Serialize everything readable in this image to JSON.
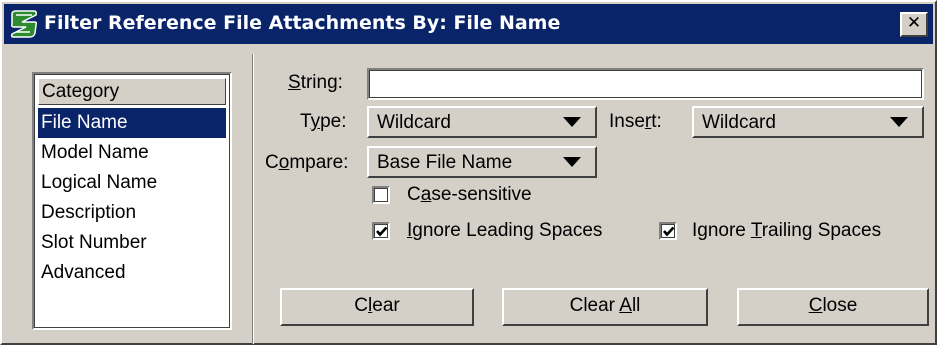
{
  "window": {
    "title": "Filter Reference File Attachments By: File Name",
    "close_label": "✕"
  },
  "category": {
    "header": "Category",
    "items": [
      "File Name",
      "Model Name",
      "Logical Name",
      "Description",
      "Slot Number",
      "Advanced"
    ],
    "selected": "File Name"
  },
  "form": {
    "string_label_pre": "",
    "string_label_key": "S",
    "string_label_post": "tring:",
    "string_value": "",
    "type_label_pre": "T",
    "type_label_key": "y",
    "type_label_post": "pe:",
    "type_value": "Wildcard",
    "insert_label_pre": "Inse",
    "insert_label_key": "r",
    "insert_label_post": "t:",
    "insert_value": "Wildcard",
    "compare_label_pre": "C",
    "compare_label_key": "o",
    "compare_label_post": "mpare:",
    "compare_value": "Base File Name",
    "case_pre": "C",
    "case_key": "a",
    "case_post": "se-sensitive",
    "case_checked": false,
    "lead_pre": "",
    "lead_key": "I",
    "lead_post": "gnore Leading Spaces",
    "lead_checked": true,
    "trail_pre": "Ignore ",
    "trail_key": "T",
    "trail_post": "railing Spaces",
    "trail_checked": true
  },
  "buttons": {
    "clear_pre": "C",
    "clear_key": "l",
    "clear_post": "ear",
    "clear_all_pre": "Clear ",
    "clear_all_key": "A",
    "clear_all_post": "ll",
    "close_pre": "",
    "close_key": "C",
    "close_post": "lose"
  }
}
